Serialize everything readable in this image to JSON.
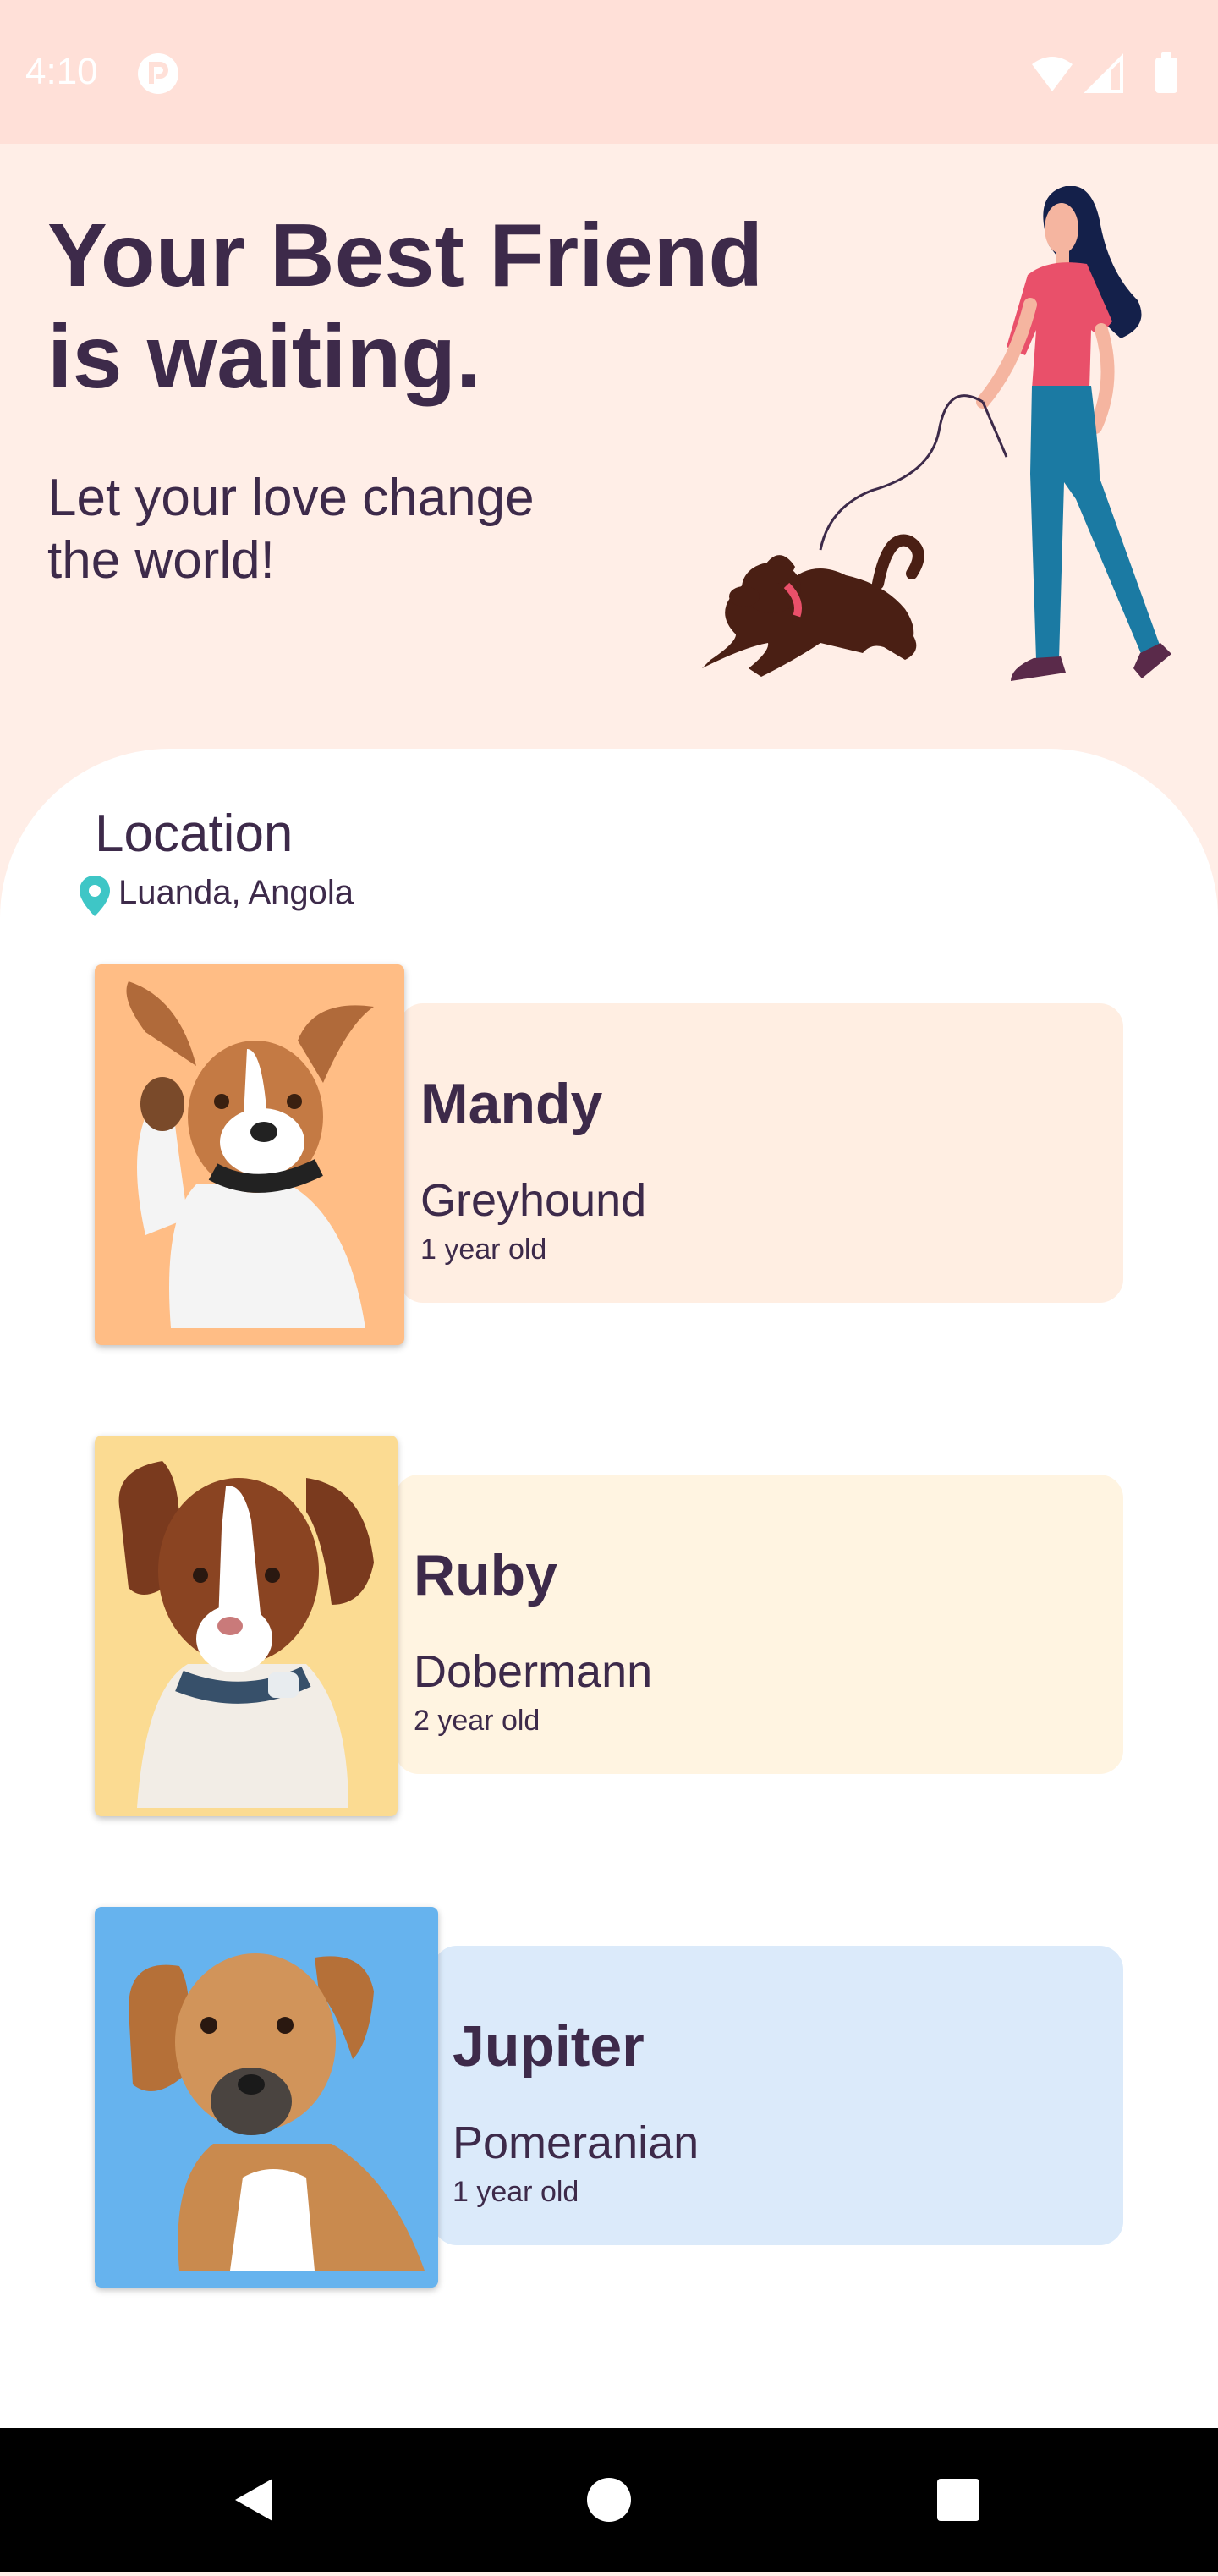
{
  "status_bar": {
    "time": "4:10"
  },
  "hero": {
    "title": "Your Best Friend is waiting.",
    "subtitle": "Let your love change the world!"
  },
  "location": {
    "label": "Location",
    "value": "Luanda, Angola"
  },
  "pets": [
    {
      "name": "Mandy",
      "breed": "Greyhound",
      "age": "1 year old",
      "photo_bg": "#ffbd85",
      "card_bg": "#ffeee2"
    },
    {
      "name": "Ruby",
      "breed": "Dobermann",
      "age": "2 year old",
      "photo_bg": "#fbdb92",
      "card_bg": "#fff4e1"
    },
    {
      "name": "Jupiter",
      "breed": "Pomeranian",
      "age": "1 year old",
      "photo_bg": "#66b3ee",
      "card_bg": "#dbeafa"
    }
  ],
  "colors": {
    "text": "#3d2a4a",
    "hero_bg": "#ffeee7",
    "status_bg": "#ffe0d8",
    "pin": "#3ec6c6"
  },
  "icons": [
    "app-logo-icon",
    "wifi-icon",
    "signal-icon",
    "battery-icon",
    "location-pin-icon",
    "back-icon",
    "home-icon",
    "recents-icon"
  ]
}
